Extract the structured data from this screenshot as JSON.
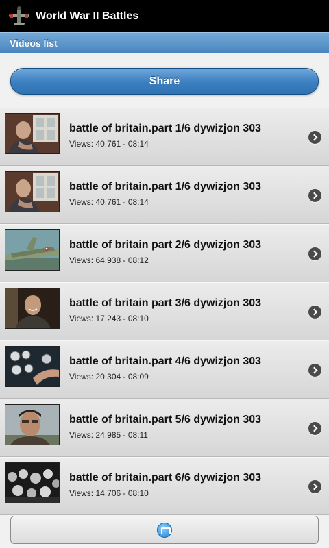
{
  "app": {
    "title": "World War II Battles",
    "icon": "plane-icon"
  },
  "subheader": {
    "title": "Videos list"
  },
  "share": {
    "label": "Share"
  },
  "videos": [
    {
      "title": "battle of britain.part 1/6 dywizjon 303",
      "meta": "Views: 40,761 - 08:14",
      "thumb": "man-portrait-window"
    },
    {
      "title": "battle of britain.part 1/6 dywizjon 303",
      "meta": "Views: 40,761 - 08:14",
      "thumb": "man-portrait-window"
    },
    {
      "title": "battle of britain part 2/6 dywizjon 303",
      "meta": "Views: 64,938 - 08:12",
      "thumb": "spitfire-plane"
    },
    {
      "title": "battle of britain part 3/6 dywizjon 303",
      "meta": "Views: 17,243 - 08:10",
      "thumb": "smiling-pilot"
    },
    {
      "title": "battle of britain.part 4/6 dywizjon 303",
      "meta": "Views: 20,304 - 08:09",
      "thumb": "cockpit-gauges"
    },
    {
      "title": "battle of britain.part 5/6 dywizjon 303",
      "meta": "Views: 24,985 - 08:11",
      "thumb": "pilot-closeup"
    },
    {
      "title": "battle of britain.part 6/6 dywizjon 303",
      "meta": "Views: 14,706 - 08:10",
      "thumb": "bw-crowd"
    }
  ],
  "footer": {
    "icon": "bookmark-icon"
  },
  "colors": {
    "header_bg": "#000000",
    "subheader_blue": "#4a86bf",
    "button_blue": "#3b7fc0"
  }
}
